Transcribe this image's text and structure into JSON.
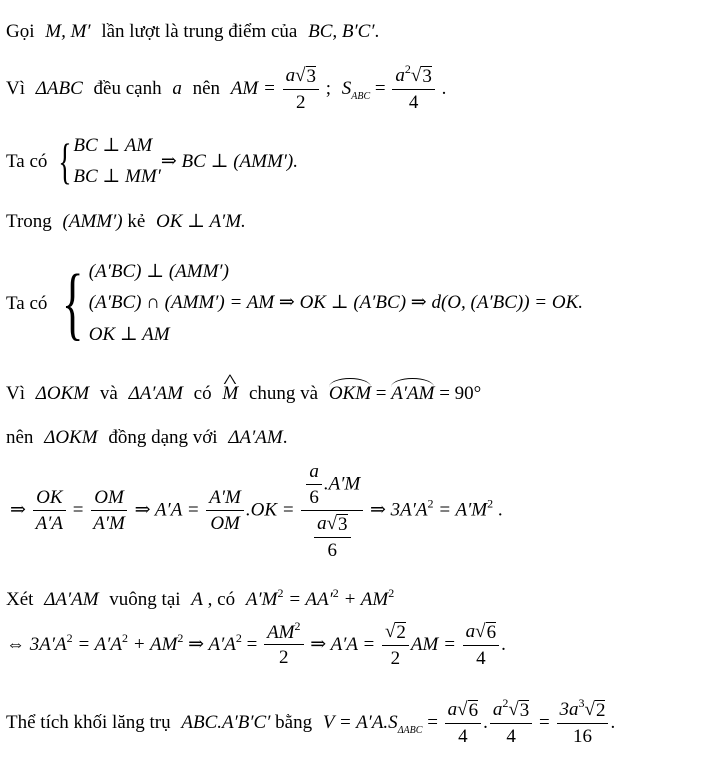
{
  "document": {
    "language": "vi",
    "line1": {
      "t1": "Gọi",
      "m1": "M, M′",
      "t2": "lần lượt là trung điểm của",
      "m2": "BC, B′C′",
      "t3": "."
    },
    "line2": {
      "t1": "Vì",
      "m1": "ΔABC",
      "t2": "đều cạnh",
      "m2": "a",
      "t3": "nên",
      "m3": "AM =",
      "frac1_num_a": "a",
      "frac1_num_root": "3",
      "frac1_den": "2",
      "t4": ";",
      "m4": "S",
      "m4_sub": "ABC",
      "m5": "=",
      "frac2_num_a": "a",
      "frac2_num_sup": "2",
      "frac2_num_root": "3",
      "frac2_den": "4",
      "t5": "."
    },
    "line3": {
      "t1": "Ta có",
      "row1": "BC ⊥ AM",
      "row2": "BC ⊥ MM′",
      "m1": "⇒ BC ⊥ (AMM′)."
    },
    "line4": {
      "t1": "Trong",
      "m1": "(AMM′)",
      "t2": "kẻ",
      "m2": "OK ⊥ A′M."
    },
    "line5": {
      "t1": "Ta có",
      "row1": "(A′BC) ⊥ (AMM′)",
      "row2": "(A′BC) ∩ (AMM′) = AM ⇒ OK ⊥ (A′BC) ⇒ d(O, (A′BC)) = OK.",
      "row3": "OK ⊥ AM"
    },
    "line6": {
      "t1": "Vì",
      "m1": "ΔOKM",
      "t2": "và",
      "m2": "ΔA′AM",
      "t3": "có",
      "m3": "M",
      "t4": "chung và",
      "m4": "OKM",
      "m5": "=",
      "m6": "A′AM",
      "m7": "= 90°"
    },
    "line7": {
      "t1": "nên",
      "m1": "ΔOKM",
      "t2": "đồng dạng với",
      "m2": "ΔA′AM",
      "t3": "."
    },
    "line8": {
      "m1": "⇒",
      "f1_num": "OK",
      "f1_den": "A′A",
      "m2": "=",
      "f2_num": "OM",
      "f2_den": "A′M",
      "m3": "⇒ A′A =",
      "f3_num": "A′M",
      "f3_den": "OM",
      "m4": ".OK =",
      "f4_num_num": "a",
      "f4_num_den": "6",
      "f4_num_tail": ".A′M",
      "f4_den_a": "a",
      "f4_den_root": "3",
      "f4_den_den": "6",
      "m5": "⇒ 3A′A",
      "m5_sup": "2",
      "m6": "= A′M",
      "m6_sup": "2",
      "t1": "."
    },
    "line9": {
      "t1": "Xét",
      "m1": "ΔA′AM",
      "t2": "vuông tại",
      "m2": "A",
      "t3": ", có",
      "m3": "A′M",
      "m3_sup": "2",
      "m4": "= AA′",
      "m4_sup": "2",
      "m5": "+ AM",
      "m5_sup": "2"
    },
    "line10": {
      "m1": "⇔ 3A′A",
      "m1_sup": "2",
      "m2": "= A′A",
      "m2_sup": "2",
      "m3": "+ AM",
      "m3_sup": "2",
      "m4": "⇒ A′A",
      "m4_sup": "2",
      "m5": "=",
      "f1_num": "AM",
      "f1_num_sup": "2",
      "f1_den": "2",
      "m6": "⇒ A′A =",
      "f2_root": "2",
      "f2_den": "2",
      "m7": "AM =",
      "f3_a": "a",
      "f3_root": "6",
      "f3_den": "4",
      "t1": "."
    },
    "line11": {
      "t1": "Thể tích khối lăng trụ",
      "m1": "ABC.A′B′C′",
      "t2": "bằng",
      "m2": "V = A′A.S",
      "m2_sub": "ΔABC",
      "m3": "=",
      "f1_a": "a",
      "f1_root": "6",
      "f1_den": "4",
      "dot": ".",
      "f2_a": "a",
      "f2_sup": "2",
      "f2_root": "3",
      "f2_den": "4",
      "m4": "=",
      "f3_pre": "3a",
      "f3_sup": "3",
      "f3_root": "2",
      "f3_den": "16",
      "t3": "."
    }
  }
}
